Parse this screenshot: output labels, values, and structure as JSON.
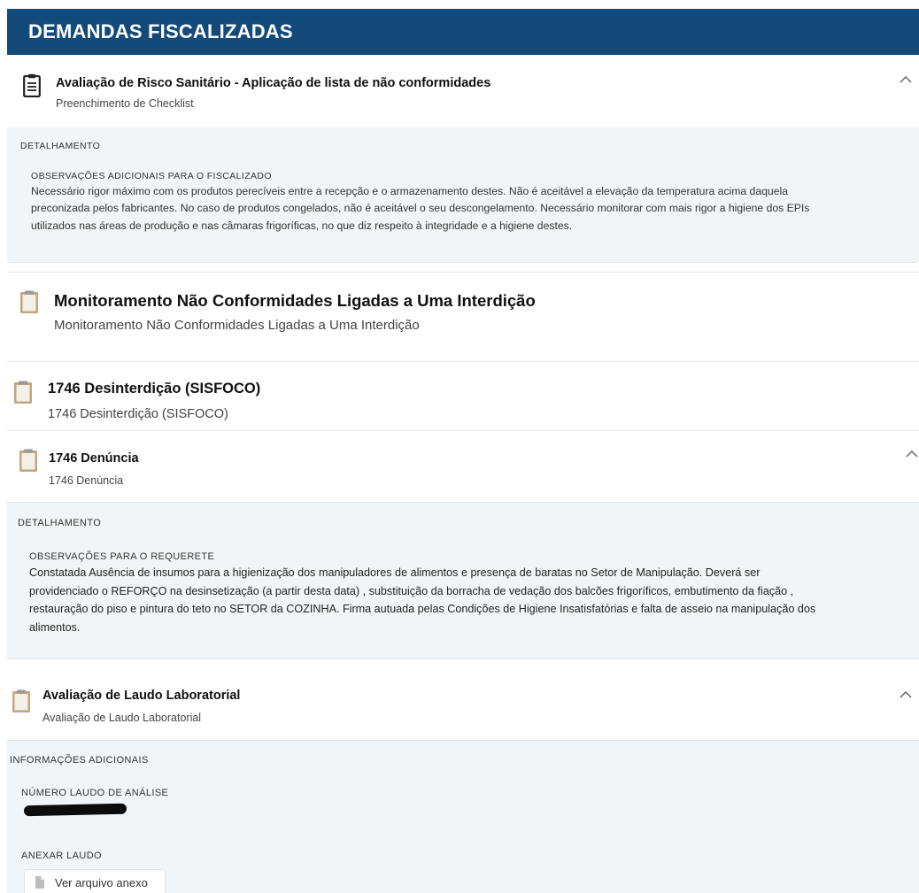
{
  "header": {
    "title": "DEMANDAS FISCALIZADAS"
  },
  "items": [
    {
      "title": "Avaliação de Risco Sanitário - Aplicação de lista de não conformidades",
      "subtitle": "Preenchimento de Checklist",
      "icon": "clipboard-icon",
      "expanded": true,
      "detail": {
        "section": "DETALHAMENTO",
        "label": "OBSERVAÇÕES ADICIONAIS PARA O FISCALIZADO",
        "lines": [
          "Necessário rigor máximo com os produtos perecíveis entre a recepção e o armazenamento destes. Não é aceitável a elevação da temperatura acima daquela",
          "preconizada pelos fabricantes. No caso de produtos congelados, não é aceitável o seu descongelamento. Necessário monitorar com mais rigor a higiene dos EPIs",
          "utilizados nas áreas de produção e nas câmaras frigoríficas, no que diz respeito à integridade e a higiene destes."
        ]
      }
    },
    {
      "title": "Monitoramento Não Conformidades Ligadas a Uma Interdição",
      "subtitle": "Monitoramento Não Conformidades Ligadas a Uma Interdição",
      "icon": "clipboard-icon",
      "expanded": false
    },
    {
      "title": "1746 Desinterdição (SISFOCO)",
      "subtitle": "1746 Desinterdição (SISFOCO)",
      "icon": "clipboard-icon",
      "expanded": false
    },
    {
      "title": "1746 Denúncia",
      "subtitle": "1746 Denúncia",
      "icon": "clipboard-icon",
      "expanded": true,
      "detail": {
        "section": "DETALHAMENTO",
        "label": "OBSERVAÇÕES PARA O REQUERETE",
        "lines": [
          "Constatada Ausência de insumos para a higienização dos manipuladores de alimentos e presença de baratas no Setor de Manipulação. Deverá ser",
          "providenciado o REFORÇO na desinsetização (a partir desta data) , substituição da borracha de vedação dos balcões frigoríficos, embutimento da fiação ,",
          "restauração do piso e pintura do teto no SETOR da COZINHA. Firma autuada pelas Condições de Higiene Insatisfatórias e falta de asseio na manipulação dos",
          "alimentos."
        ]
      }
    },
    {
      "title": "Avaliação de Laudo Laboratorial",
      "subtitle": "Avaliação de Laudo Laboratorial",
      "icon": "clipboard-icon",
      "expanded": true,
      "info": {
        "section": "INFORMAÇÕES ADICIONAIS",
        "laudo_label": "NÚMERO LAUDO DE ANÁLISE",
        "laudo_value_redacted": true,
        "anexo_label": "ANEXAR LAUDO",
        "anexo_button": "Ver arquivo anexo"
      }
    }
  ],
  "colors": {
    "header_bg": "#134a7a",
    "panel_bg": "#f1f5f7",
    "icon_board": "#c4a57c"
  }
}
